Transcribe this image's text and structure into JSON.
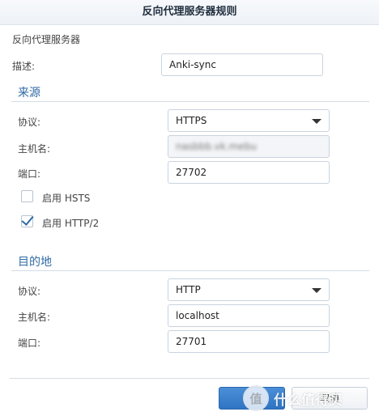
{
  "window": {
    "title": "反向代理服务器规则"
  },
  "general": {
    "heading": "反向代理服务器",
    "description_label": "描述:",
    "description_value": "Anki-sync"
  },
  "source": {
    "section_title": "来源",
    "protocol_label": "协议:",
    "protocol_value": "HTTPS",
    "hostname_label": "主机名:",
    "hostname_value": "nasbbb.vk.mebu",
    "port_label": "端口:",
    "port_value": "27702",
    "hsts_label": "启用 HSTS",
    "hsts_checked": false,
    "http2_label": "启用 HTTP/2",
    "http2_checked": true
  },
  "destination": {
    "section_title": "目的地",
    "protocol_label": "协议:",
    "protocol_value": "HTTP",
    "hostname_label": "主机名:",
    "hostname_value": "localhost",
    "port_label": "端口:",
    "port_value": "27701"
  },
  "footer": {
    "cancel_label": "取消",
    "watermark_text": "什么值得买",
    "watermark_badge": "值"
  },
  "colors": {
    "accent": "#2f6aa5",
    "primary_button": "#3a7fcc"
  }
}
